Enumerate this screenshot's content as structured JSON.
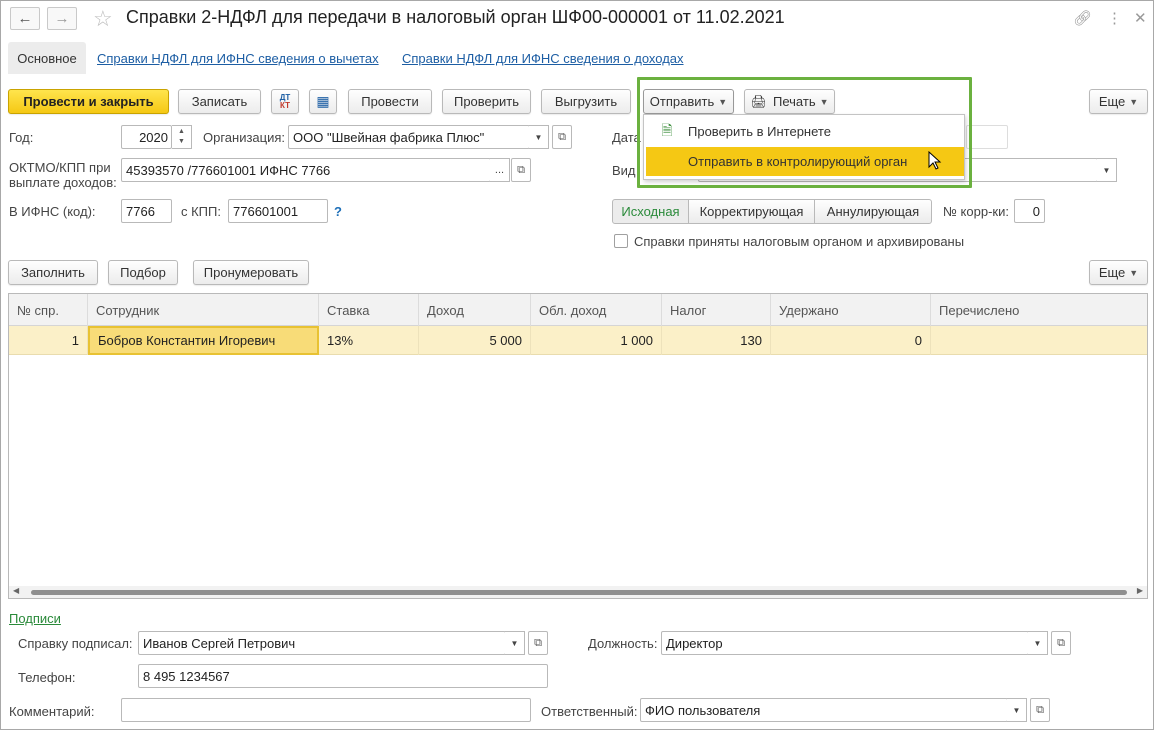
{
  "window": {
    "title": "Справки 2-НДФЛ для передачи в налоговый орган ШФ00-000001 от 11.02.2021"
  },
  "tabs": {
    "main": "Основное",
    "deductions": "Справки НДФЛ для ИФНС сведения о вычетах",
    "income": "Справки НДФЛ для ИФНС сведения о доходах"
  },
  "toolbar": {
    "post_close": "Провести и закрыть",
    "save": "Записать",
    "post": "Провести",
    "check": "Проверить",
    "export": "Выгрузить",
    "send": "Отправить",
    "print": "Печать",
    "more": "Еще"
  },
  "send_menu": {
    "items": [
      "Проверить в Интернете",
      "Отправить в контролирующий орган"
    ]
  },
  "form": {
    "year_label": "Год:",
    "year_value": "2020",
    "org_label": "Организация:",
    "org_value": "ООО \"Швейная фабрика Плюс\"",
    "oktmo_label_1": "ОКТМО/КПП  при",
    "oktmo_label_2": "выплате доходов:",
    "oktmo_value": "45393570   /776601001 ИФНС 7766",
    "oktmo_dots": "...",
    "date_label": "Дата",
    "kind_label": "Вид",
    "ifns_label": "В ИФНС (код):",
    "ifns_value": "7766",
    "kpp_label": "с КПП:",
    "kpp_value": "776601001",
    "help": "?",
    "seg": [
      "Исходная",
      "Корректирующая",
      "Аннулирующая"
    ],
    "corr_label": "№ корр-ки:",
    "corr_value": "0",
    "archived_label": "Справки приняты налоговым органом и архивированы"
  },
  "table_toolbar": {
    "fill": "Заполнить",
    "select": "Подбор",
    "renumber": "Пронумеровать",
    "more": "Еще"
  },
  "table": {
    "headers": [
      "№ спр.",
      "Сотрудник",
      "Ставка",
      "Доход",
      "Обл. доход",
      "Налог",
      "Удержано",
      "Перечислено"
    ],
    "rows": [
      [
        "1",
        "Бобров Константин Игоревич",
        "13%",
        "5 000",
        "1 000",
        "130",
        "0",
        ""
      ]
    ]
  },
  "signatures": {
    "section_link": "Подписи",
    "signed_label": "Справку подписал:",
    "signed_value": "Иванов Сергей Петрович",
    "position_label": "Должность:",
    "position_value": "Директор",
    "phone_label": "Телефон:",
    "phone_value": "8 495 1234567"
  },
  "footer": {
    "comment_label": "Комментарий:",
    "comment_value": "",
    "responsible_label": "Ответственный:",
    "responsible_value": "ФИО пользователя"
  },
  "colors": {
    "accent_yellow": "#f5c814",
    "link_blue": "#1d5ea4",
    "green_link": "#2a8a3a",
    "highlight_border": "#6bb13f",
    "row_highlight": "#fbf0c8"
  }
}
